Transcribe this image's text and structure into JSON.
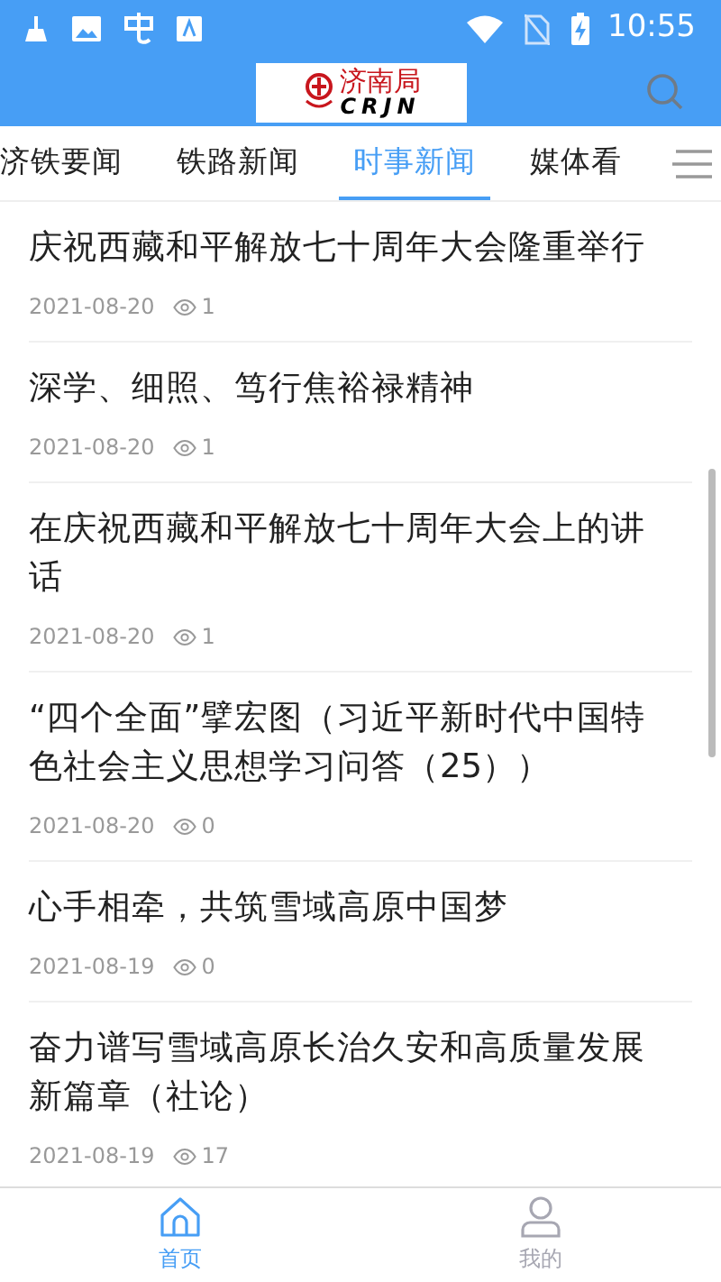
{
  "status_bar": {
    "time": "10:55"
  },
  "header": {
    "logo_text": "济南局",
    "logo_subtext": "CRJN"
  },
  "tabs": [
    {
      "label": "济铁要闻",
      "selected": false
    },
    {
      "label": "铁路新闻",
      "selected": false
    },
    {
      "label": "时事新闻",
      "selected": true
    },
    {
      "label": "媒体看",
      "selected": false
    }
  ],
  "articles": [
    {
      "title": "庆祝西藏和平解放七十周年大会隆重举行",
      "date": "2021-08-20",
      "views": "1"
    },
    {
      "title": "深学、细照、笃行焦裕禄精神",
      "date": "2021-08-20",
      "views": "1"
    },
    {
      "title": "在庆祝西藏和平解放七十周年大会上的讲话",
      "date": "2021-08-20",
      "views": "1"
    },
    {
      "title": "“四个全面”擘宏图（习近平新时代中国特色社会主义思想学习问答（25））",
      "date": "2021-08-20",
      "views": "0"
    },
    {
      "title": "心手相牵，共筑雪域高原中国梦",
      "date": "2021-08-19",
      "views": "0"
    },
    {
      "title": "奋力谱写雪域高原长治久安和高质量发展新篇章（社论）",
      "date": "2021-08-19",
      "views": "17"
    }
  ],
  "bottom_nav": [
    {
      "label": "首页",
      "kind": "home",
      "selected": true
    },
    {
      "label": "我的",
      "kind": "profile",
      "selected": false
    }
  ]
}
